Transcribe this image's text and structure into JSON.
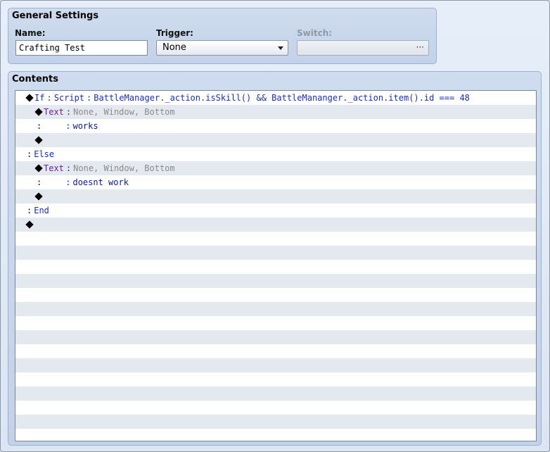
{
  "general": {
    "title": "General Settings",
    "name_label": "Name:",
    "name_value": "Crafting Test",
    "trigger_label": "Trigger:",
    "trigger_value": "None",
    "switch_label": "Switch:",
    "switch_button": "···"
  },
  "contents": {
    "title": "Contents",
    "lines": [
      {
        "keyword": "If",
        "sep": ":",
        "kind": "Script",
        "sep2": ":",
        "expr": "BattleManager._action.isSkill() && BattleMananger._action.item().id === 48"
      },
      {
        "command": "Text",
        "sep": ":",
        "params": "None, Window, Bottom"
      },
      {
        "colon_a": ":",
        "colon_b": ":",
        "text": "works"
      },
      {},
      {
        "colon": ":",
        "keyword": "Else"
      },
      {
        "command": "Text",
        "sep": ":",
        "params": "None, Window, Bottom"
      },
      {
        "colon_a": ":",
        "colon_b": ":",
        "text": "doesnt work"
      },
      {},
      {
        "colon": ":",
        "keyword": "End"
      },
      {}
    ]
  }
}
